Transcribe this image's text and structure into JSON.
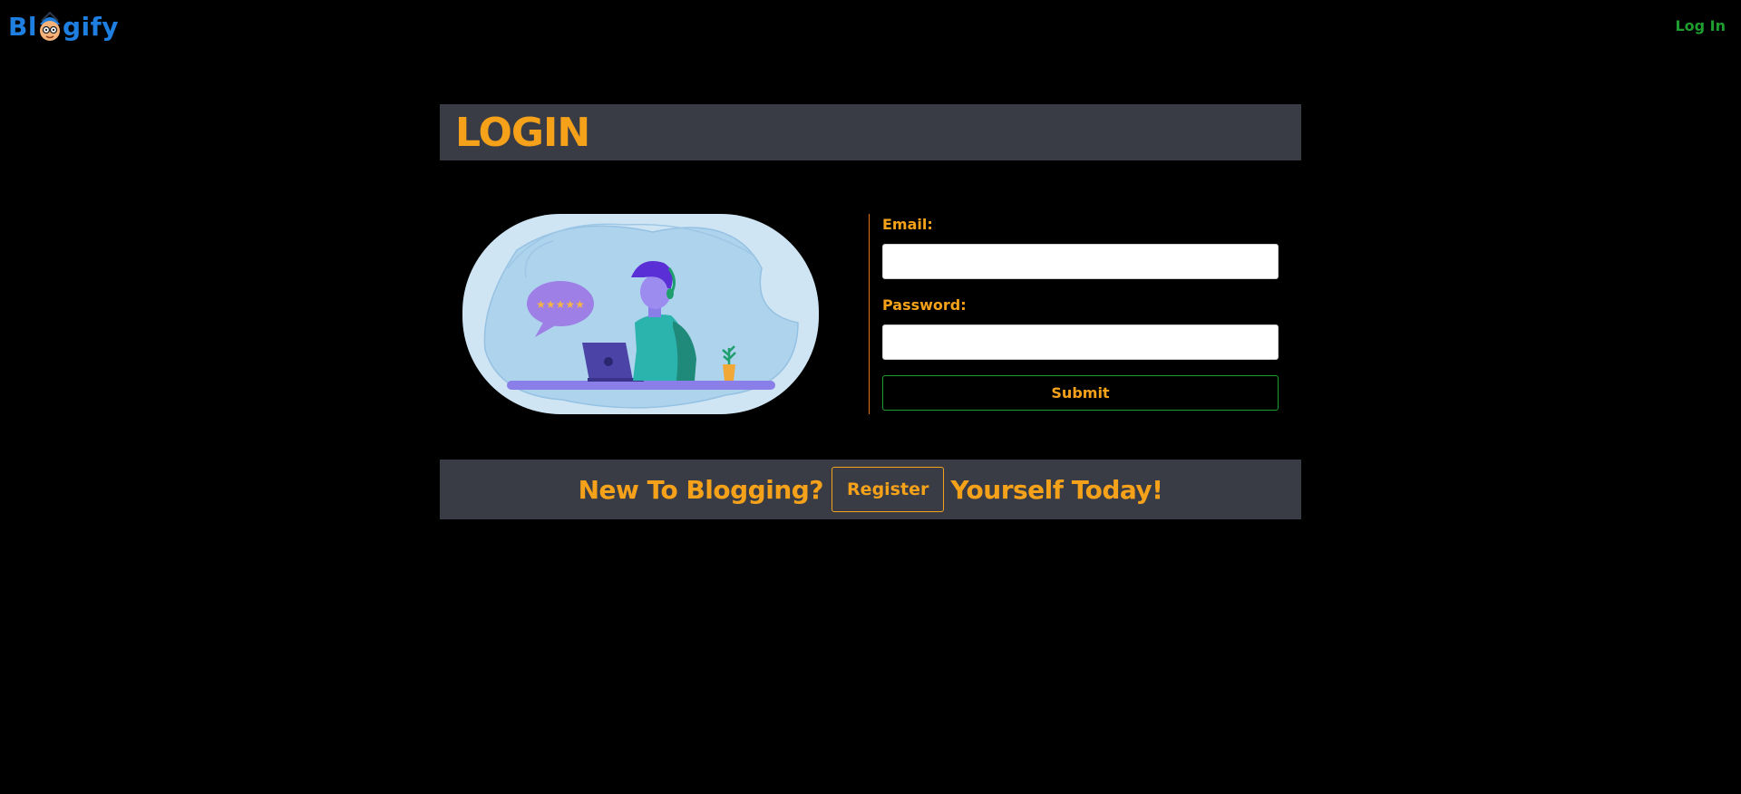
{
  "navbar": {
    "brand_prefix": "Bl",
    "brand_suffix": "gify",
    "login_link": "Log In"
  },
  "page": {
    "title": "LOGIN"
  },
  "illustration": {
    "icon": "customer-support-illustration",
    "rating_stars": "★★★★★"
  },
  "form": {
    "email_label": "Email:",
    "email_value": "",
    "password_label": "Password:",
    "password_value": "",
    "submit_label": "Submit"
  },
  "footer": {
    "prefix": "New To Blogging?",
    "register_label": "Register",
    "suffix": "Yourself Today!"
  },
  "colors": {
    "background": "#000000",
    "brand_blue": "#1e7fe0",
    "accent_orange": "#f5a21a",
    "link_green": "#1e9e2e",
    "panel_gray": "#393c44"
  }
}
